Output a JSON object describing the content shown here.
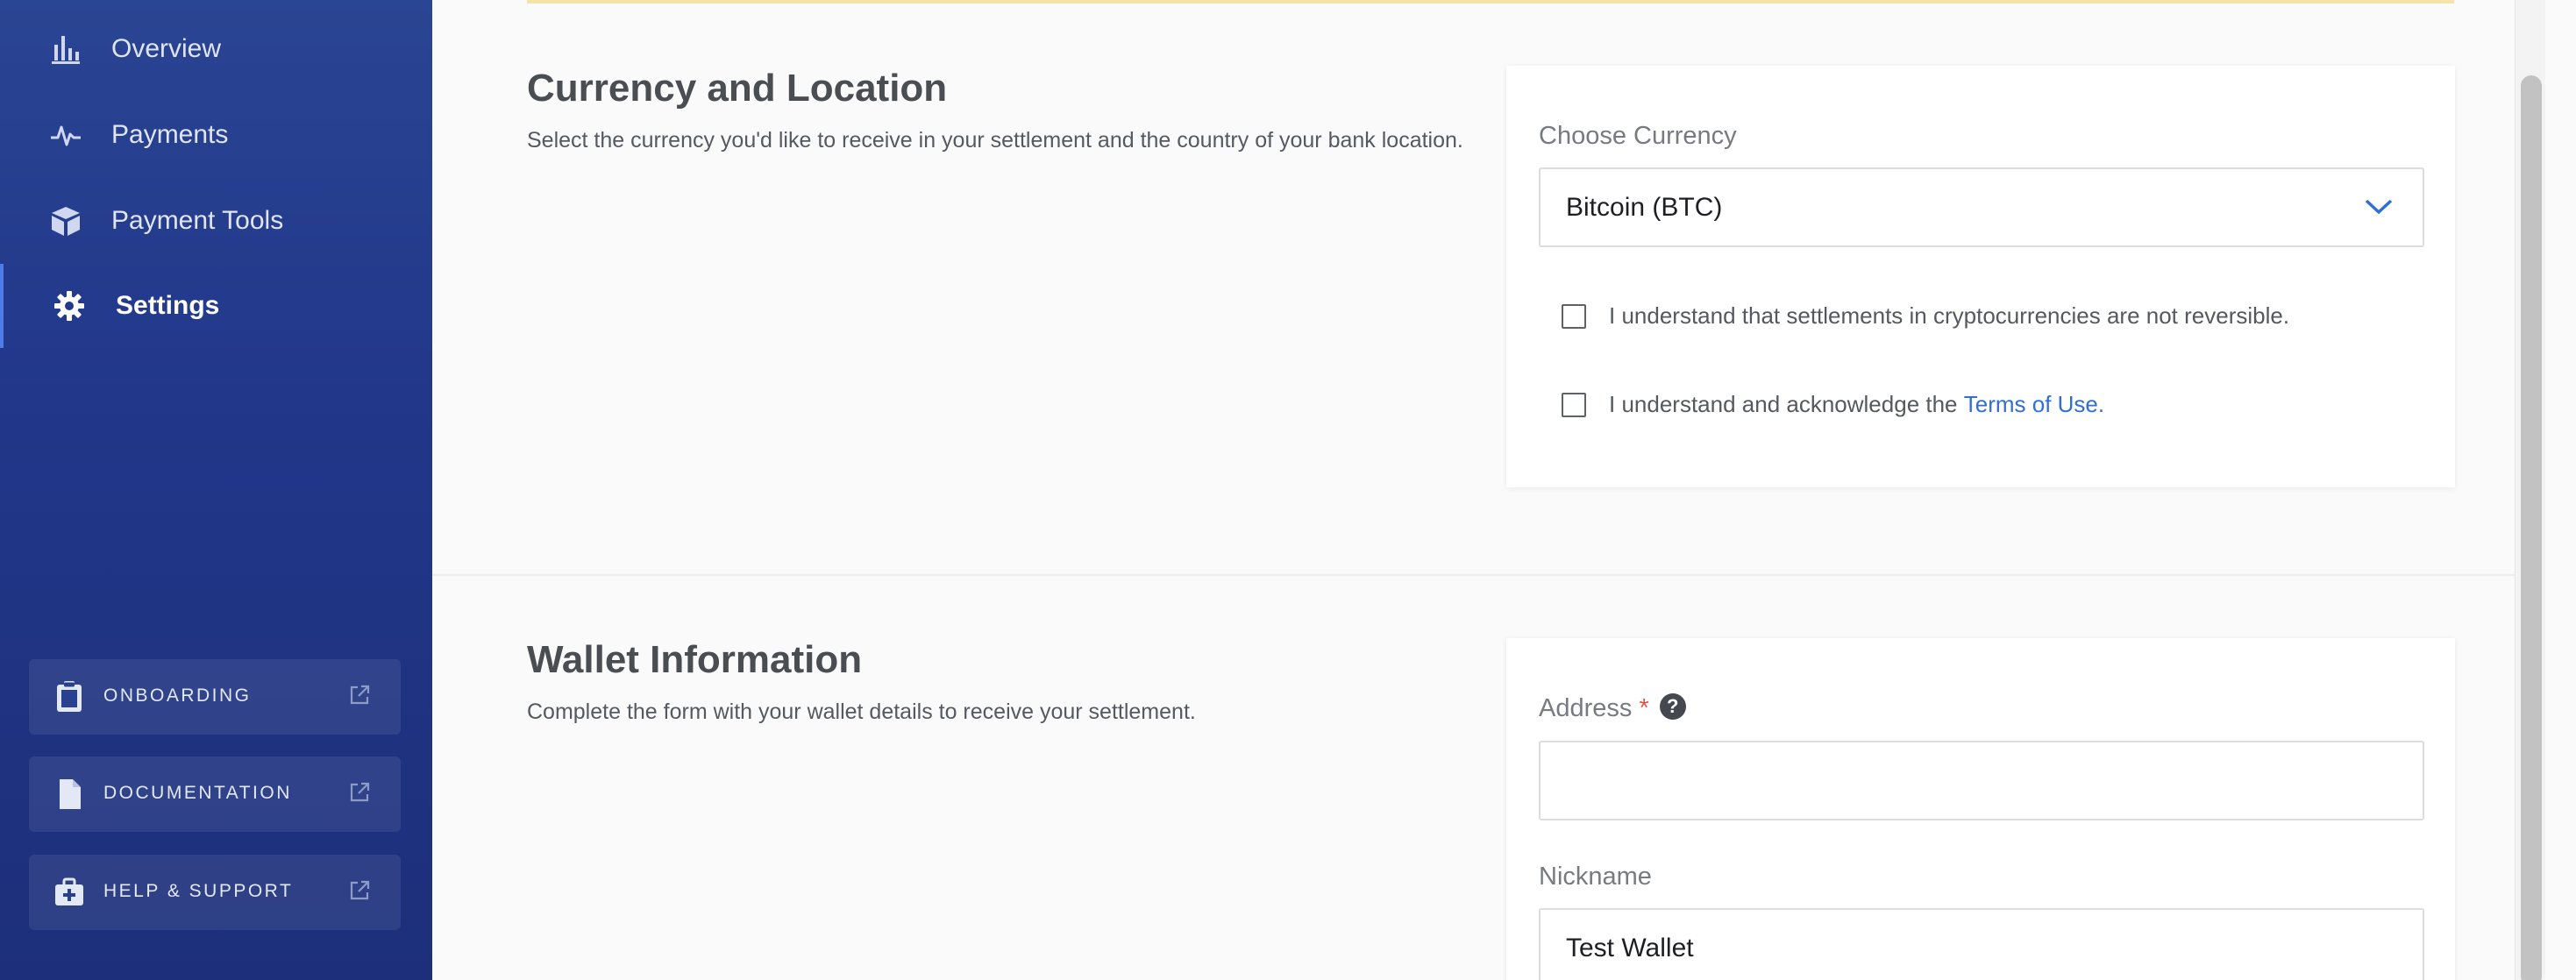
{
  "sidebar": {
    "nav": [
      {
        "label": "Overview",
        "icon": "bar-chart-icon"
      },
      {
        "label": "Payments",
        "icon": "activity-icon"
      },
      {
        "label": "Payment Tools",
        "icon": "box-icon"
      },
      {
        "label": "Settings",
        "icon": "gear-icon",
        "active": true
      }
    ],
    "external": [
      {
        "label": "ONBOARDING",
        "icon": "clipboard-icon"
      },
      {
        "label": "DOCUMENTATION",
        "icon": "document-icon"
      },
      {
        "label": "HELP & SUPPORT",
        "icon": "first-aid-kit-icon"
      }
    ]
  },
  "currency_section": {
    "title": "Currency and Location",
    "description": "Select the currency you'd like to receive in your settlement and the country of your bank location.",
    "currency_label": "Choose Currency",
    "currency_value": "Bitcoin (BTC)",
    "check_reversible": "I understand that settlements in cryptocurrencies are not reversible.",
    "check_terms_prefix": "I understand and acknowledge the ",
    "check_terms_link": "Terms of Use",
    "check_terms_suffix": "."
  },
  "wallet_section": {
    "title": "Wallet Information",
    "description": "Complete the form with your wallet details to receive your settlement.",
    "address_label": "Address",
    "address_required_mark": "*",
    "address_help": "?",
    "address_value": "",
    "nickname_label": "Nickname",
    "nickname_value": "Test Wallet"
  },
  "colors": {
    "sidebar_top": "#2a4593",
    "sidebar_bottom": "#1d2f7a",
    "active_accent": "#4f7be8",
    "link": "#2f6fd6",
    "required": "#e0554a"
  }
}
